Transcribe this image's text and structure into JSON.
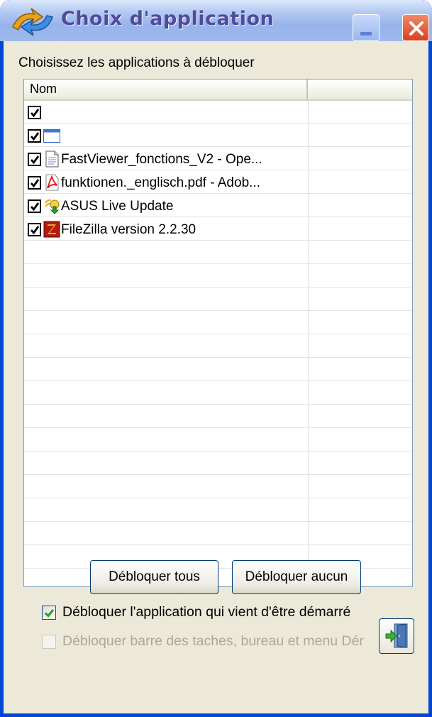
{
  "window": {
    "title": "Choix d'application"
  },
  "instruction": "Choisissez les applications à débloquer",
  "list": {
    "column_header": "Nom",
    "items": [
      {
        "label": "",
        "checked": true,
        "icon": "none"
      },
      {
        "label": "",
        "checked": true,
        "icon": "window-icon"
      },
      {
        "label": "FastViewer_fonctions_V2 - Ope...",
        "checked": true,
        "icon": "document-icon"
      },
      {
        "label": "funktionen._englisch.pdf - Adob...",
        "checked": true,
        "icon": "pdf-icon"
      },
      {
        "label": "ASUS Live Update",
        "checked": true,
        "icon": "asus-update-icon"
      },
      {
        "label": "FileZilla version 2.2.30",
        "checked": true,
        "icon": "filezilla-icon"
      }
    ]
  },
  "buttons": {
    "unblock_all": "Débloquer tous",
    "unblock_none": "Débloquer aucun"
  },
  "options": {
    "unblock_started": {
      "label": "Débloquer l'application qui vient d'être démarré",
      "checked": true,
      "enabled": true
    },
    "unblock_taskbar": {
      "label": "Débloquer barre des taches, bureau et menu Dér",
      "checked": false,
      "enabled": false
    }
  },
  "colors": {
    "frame": "#0046d5",
    "face": "#ece9d8",
    "title_text": "#4f4c9b"
  }
}
